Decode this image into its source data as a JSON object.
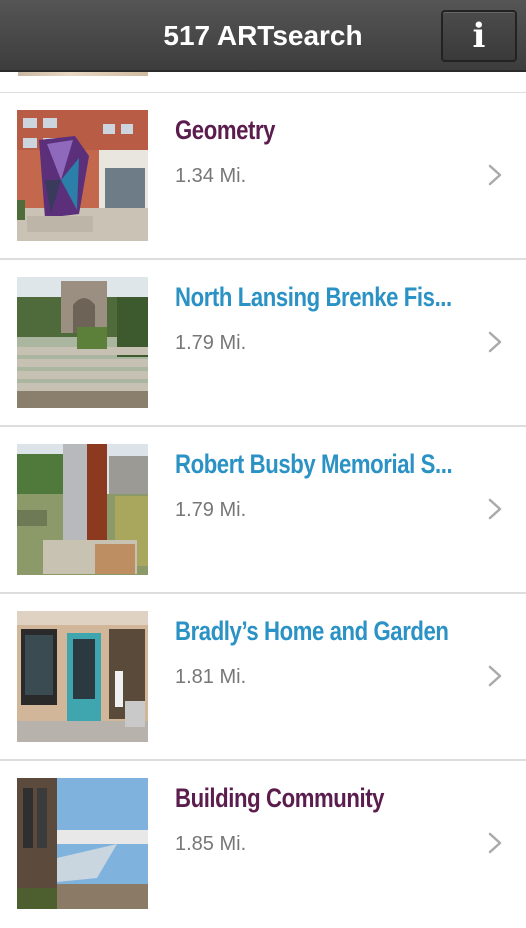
{
  "app": {
    "title": "517 ARTsearch",
    "info_label": "i"
  },
  "colors": {
    "header_bg": "#464646",
    "title_purple": "#5a1d4e",
    "title_teal": "#2a92c4",
    "distance_gray": "#777777",
    "chevron_gray": "#aaaaaa"
  },
  "items": [
    {
      "title": "Geometry",
      "distance": "1.34 Mi.",
      "title_color": "#5a1d4e",
      "icon": "chevron-right-icon"
    },
    {
      "title": "North Lansing Brenke Fis...",
      "distance": "1.79 Mi.",
      "title_color": "#2a92c4",
      "icon": "chevron-right-icon"
    },
    {
      "title": "Robert Busby Memorial S...",
      "distance": "1.79 Mi.",
      "title_color": "#2a92c4",
      "icon": "chevron-right-icon"
    },
    {
      "title": "Bradly’s Home and Garden",
      "distance": "1.81 Mi.",
      "title_color": "#2a92c4",
      "icon": "chevron-right-icon"
    },
    {
      "title": "Building Community",
      "distance": "1.85 Mi.",
      "title_color": "#5a1d4e",
      "icon": "chevron-right-icon"
    }
  ]
}
